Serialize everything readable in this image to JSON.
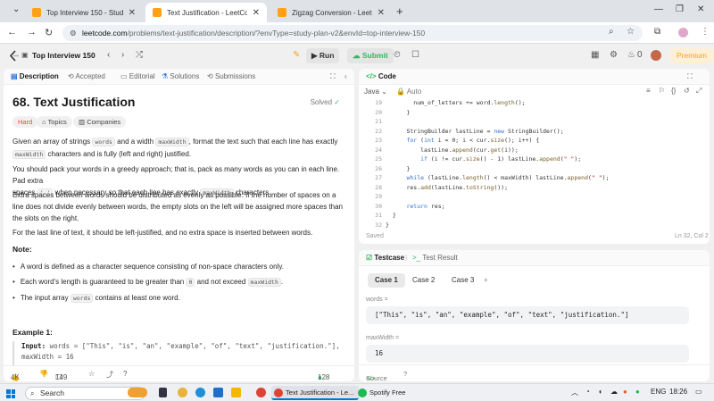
{
  "browser": {
    "tabs": [
      {
        "title": "Top Interview 150 - Study Plan",
        "active": false
      },
      {
        "title": "Text Justification - LeetCode",
        "active": true
      },
      {
        "title": "Zigzag Conversion - LeetCode",
        "active": false
      }
    ],
    "url_host": "leetcode.com",
    "url_rest": "/problems/text-justification/description/?envType=study-plan-v2&envId=top-interview-150"
  },
  "header": {
    "plan": "Top Interview 150",
    "run_label": "Run",
    "submit_label": "Submit",
    "coins": "0",
    "premium_label": "Premium"
  },
  "left_tabs": [
    {
      "label": "Description"
    },
    {
      "label": "Accepted"
    },
    {
      "label": "Editorial"
    },
    {
      "label": "Solutions"
    },
    {
      "label": "Submissions"
    }
  ],
  "problem": {
    "title": "68. Text Justification",
    "status": "Solved",
    "difficulty": "Hard",
    "topics_label": "Topics",
    "companies_label": "Companies",
    "p1a": "Given an array of strings ",
    "p1_code1": "words",
    "p1b": " and a width ",
    "p1_code2": "maxWidth",
    "p1c": ", format the text such that each line has exactly",
    "p1_code3": "maxWidth",
    "p1d": " characters and is fully (left and right) justified.",
    "p2a": "You should pack your words in a greedy approach; that is, pack as many words as you can in each line. Pad extra",
    "p2b": "spaces ",
    "p2_code": "' '",
    "p2c": " when necessary so that each line has exactly ",
    "p2_code2": "maxWidth",
    "p2d": " characters.",
    "p3": "Extra spaces between words should be distributed as evenly as possible. If the number of spaces on a line does not divide evenly between words, the empty slots on the left will be assigned more spaces than the slots on the right.",
    "p4": "For the last line of text, it should be left-justified, and no extra space is inserted between words.",
    "note_title": "Note:",
    "b1": "A word is defined as a character sequence consisting of non-space characters only.",
    "b2a": "Each word's length is guaranteed to be greater than ",
    "b2_code": "0",
    "b2b": " and not exceed ",
    "b2_code2": "maxWidth",
    "b2c": ".",
    "b3a": "The input array ",
    "b3_code": "words",
    "b3b": " contains at least one word.",
    "example_title": "Example 1:",
    "ex_input_label": "Input:",
    "ex_input": " words = [\"This\", \"is\", \"an\", \"example\", \"of\", \"text\", \"justification.\"],",
    "ex_input2": "maxWidth = 16"
  },
  "left_footer": {
    "likes": "4K",
    "comments": "149",
    "online": "128 Online"
  },
  "code_panel": {
    "title": "Code",
    "language": "Java",
    "mode": "Auto",
    "saved_label": "Saved",
    "cursor_pos": "Ln 32, Col 2",
    "lines": [
      {
        "n": "19",
        "html": "        num_of_letters += word.<span class=\"fn\">length</span>();"
      },
      {
        "n": "20",
        "html": "      }"
      },
      {
        "n": "21",
        "html": ""
      },
      {
        "n": "22",
        "html": "      StringBuilder lastLine = <span class=\"kw\">new</span> StringBuilder();"
      },
      {
        "n": "23",
        "html": "      <span class=\"kw\">for</span> (<span class=\"kw\">int</span> i = 0; i &lt; cur.<span class=\"fn\">size</span>(); i++) {"
      },
      {
        "n": "24",
        "html": "          lastLine.<span class=\"fn\">append</span>(cur.<span class=\"fn\">get</span>(i));"
      },
      {
        "n": "25",
        "html": "          <span class=\"kw\">if</span> (i != cur.<span class=\"fn\">size</span>() - 1) lastLine.<span class=\"fn\">append</span>(<span class=\"str\">\" \"</span>);"
      },
      {
        "n": "26",
        "html": "      }"
      },
      {
        "n": "27",
        "html": "      <span class=\"kw\">while</span> (lastLine.<span class=\"fn\">length</span>() &lt; maxWidth) lastLine.<span class=\"fn\">append</span>(<span class=\"str\">\" \"</span>);"
      },
      {
        "n": "28",
        "html": "      res.<span class=\"fn\">add</span>(lastLine.<span class=\"fn\">toString</span>());"
      },
      {
        "n": "29",
        "html": ""
      },
      {
        "n": "30",
        "html": "      <span class=\"kw\">return</span> res;"
      },
      {
        "n": "31",
        "html": "  }"
      },
      {
        "n": "32",
        "html": "}"
      }
    ]
  },
  "test_panel": {
    "tabs": [
      {
        "label": "Testcase"
      },
      {
        "label": "Test Result"
      }
    ],
    "cases": [
      {
        "label": "Case 1"
      },
      {
        "label": "Case 2"
      },
      {
        "label": "Case 3"
      }
    ],
    "add_label": "+",
    "field1_label": "words =",
    "field1_value": "[\"This\", \"is\", \"an\", \"example\", \"of\", \"text\", \"justification.\"]",
    "field2_label": "maxWidth =",
    "field2_value": "16",
    "source_label": "Source"
  },
  "taskbar": {
    "search_label": "Search",
    "task1": "Text Justification - Le...",
    "task2": "Spotify Free",
    "lang": "ENG",
    "time": "18:26"
  },
  "colors": {
    "accent_green": "#2cbb5d",
    "hard_red": "#ef4743",
    "premium_orange": "#ffa116"
  }
}
